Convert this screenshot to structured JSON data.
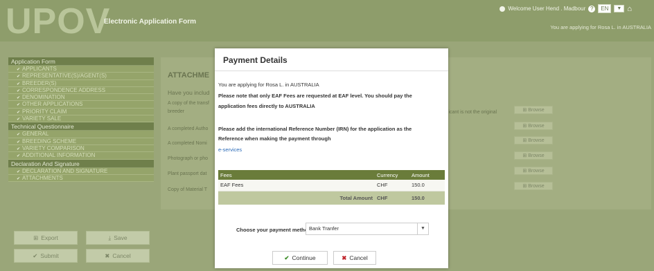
{
  "header": {
    "logo": "UPOV",
    "app_title": "Electronic Application Form",
    "welcome": "Welcome User Hend . Madbour",
    "language": "EN",
    "applying_text": "You are applying for Rosa L. in AUSTRALIA"
  },
  "sidebar": {
    "sections": [
      {
        "title": "Application Form",
        "items": [
          "APPLICANTS",
          "REPRESENTATIVE(S)/AGENT(S)",
          "BREEDER(S)",
          "CORRESPONDENCE ADDRESS",
          "DENOMINATION",
          "OTHER APPLICATIONS",
          "PRIORITY CLAIM",
          "VARIETY SALE"
        ]
      },
      {
        "title": "Technical Questionnaire",
        "items": [
          "GENERAL",
          "BREEDING SCHEME",
          "VARIETY COMPARISON",
          "ADDITIONAL INFORMATION"
        ]
      },
      {
        "title": "Declaration And Signature",
        "items": [
          "DECLARATION AND SIGNATURE",
          "ATTACHMENTS"
        ]
      }
    ],
    "buttons": {
      "export": "Export",
      "save": "Save",
      "submit": "Submit",
      "cancel": "Cancel"
    }
  },
  "main": {
    "title": "ATTACHME",
    "question": "Have you includ",
    "rows": [
      "A copy of the transf",
      "breeder",
      "A completed Autho",
      "A completed Nomi",
      "Photograph or pho",
      "Plant passport dat",
      "Copy of Material T"
    ],
    "right_text": "plicant is not the original",
    "browse_label": "Browse"
  },
  "modal": {
    "title": "Payment Details",
    "line1": "You are applying for Rosa L. in AUSTRALIA",
    "line2": "Please note that only EAF Fees are requested at EAF level. You should pay the",
    "line3": "application fees directly to AUSTRALIA",
    "line4": "Please add the international Reference Number (IRN) for the application as the",
    "line5": "Reference when making the payment through",
    "link": "e-services",
    "table": {
      "headers": [
        "Fees",
        "Currency",
        "Amount"
      ],
      "rows": [
        [
          "EAF Fees",
          "CHF",
          "150.0"
        ]
      ],
      "total": {
        "label": "Total Amount",
        "currency": "CHF",
        "amount": "150.0"
      }
    },
    "method_label": "Choose your payment method",
    "method_value": "Bank Tranfer",
    "continue": "Continue",
    "cancel": "Cancel"
  }
}
